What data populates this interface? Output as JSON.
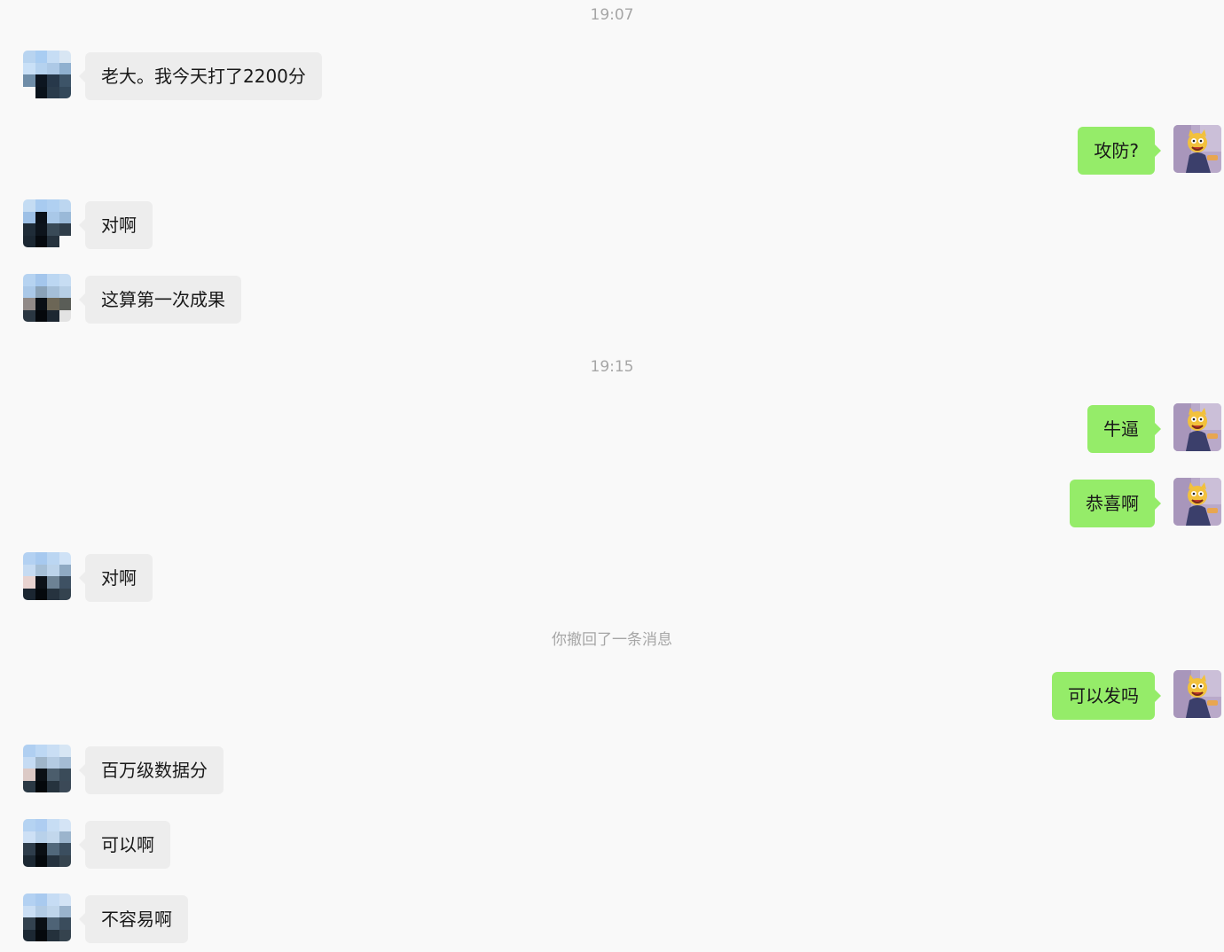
{
  "colors": {
    "background": "#f9f9f9",
    "incoming_bubble": "#ededed",
    "outgoing_bubble": "#95ec69",
    "system_text": "#a6a6a6"
  },
  "timestamps": {
    "t1": "19:07",
    "t2": "19:15"
  },
  "system_notice": "你撤回了一条消息",
  "messages": [
    {
      "from": "contact",
      "text": "老大。我今天打了2200分"
    },
    {
      "from": "me",
      "text": "攻防?"
    },
    {
      "from": "contact",
      "text": "对啊"
    },
    {
      "from": "contact",
      "text": "这算第一次成果"
    },
    {
      "from": "me",
      "text": "牛逼"
    },
    {
      "from": "me",
      "text": "恭喜啊"
    },
    {
      "from": "contact",
      "text": "对啊"
    },
    {
      "from": "me",
      "text": "可以发吗"
    },
    {
      "from": "contact",
      "text": "百万级数据分"
    },
    {
      "from": "contact",
      "text": "可以啊"
    },
    {
      "from": "contact",
      "text": "不容易啊"
    }
  ],
  "icons": {
    "contact_avatar": "pixelated-avatar-icon",
    "my_avatar": "cartoon-cat-avatar-icon"
  }
}
